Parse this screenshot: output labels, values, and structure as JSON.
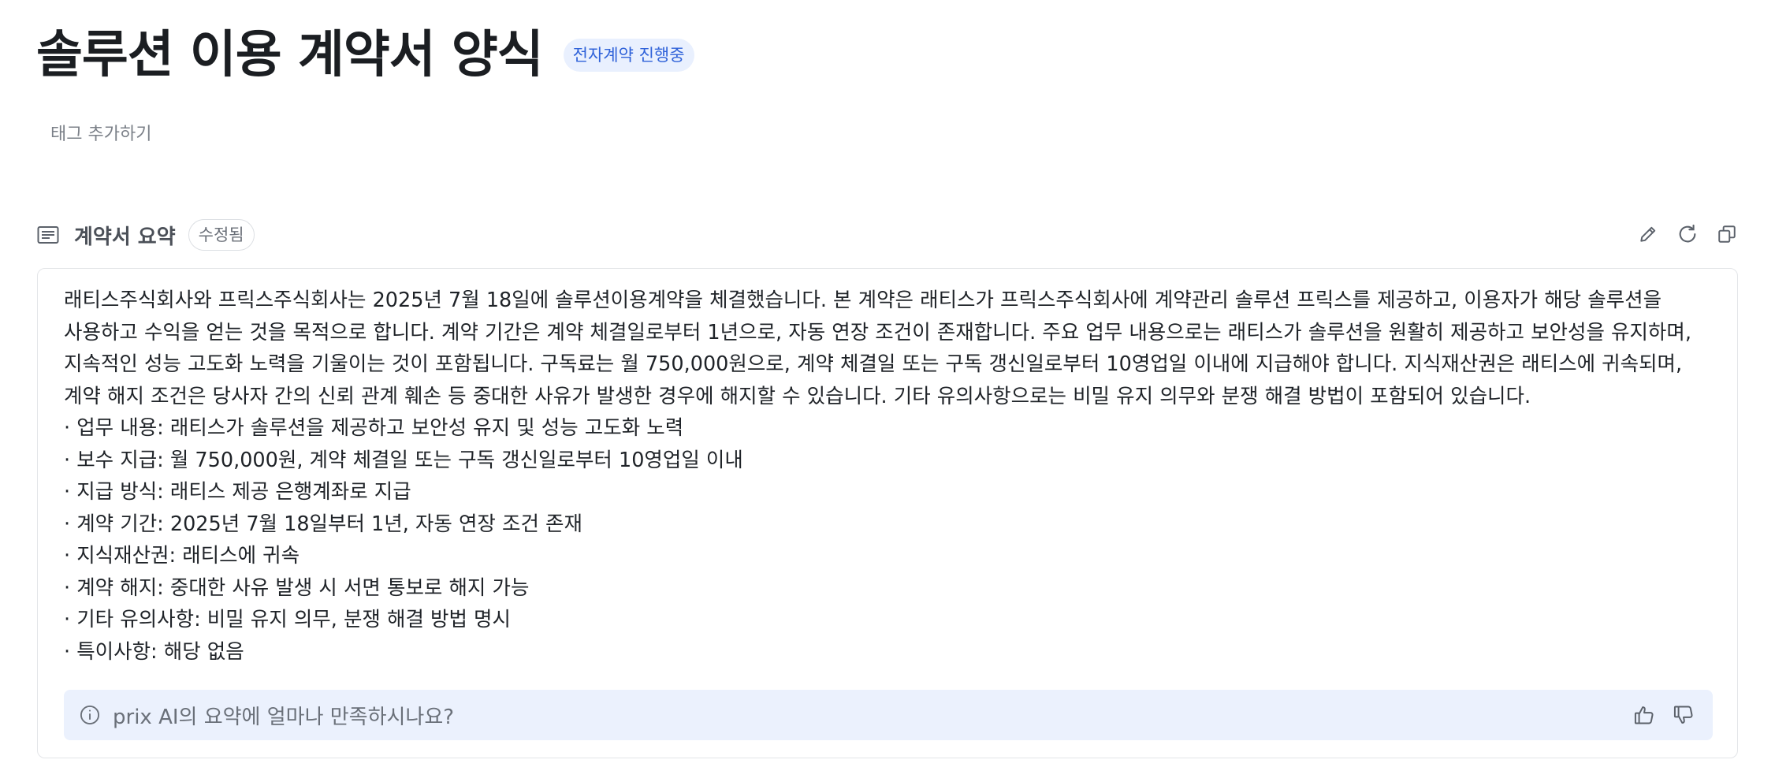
{
  "header": {
    "title": "솔루션 이용 계약서 양식",
    "status_badge": "전자계약 진행중",
    "tag_add_label": "태그 추가하기"
  },
  "summary": {
    "section_title": "계약서 요약",
    "edited_badge": "수정됨",
    "icons": [
      "document-lines-icon",
      "pencil-icon",
      "refresh-icon",
      "copy-icon"
    ],
    "paragraph": "래티스주식회사와 프릭스주식회사는 2025년 7월 18일에 솔루션이용계약을 체결했습니다. 본 계약은 래티스가 프릭스주식회사에 계약관리 솔루션 프릭스를 제공하고, 이용자가 해당 솔루션을 사용하고 수익을 얻는 것을 목적으로 합니다. 계약 기간은 계약 체결일로부터 1년으로, 자동 연장 조건이 존재합니다. 주요 업무 내용으로는 래티스가 솔루션을 원활히 제공하고 보안성을 유지하며, 지속적인 성능 고도화 노력을 기울이는 것이 포함됩니다. 구독료는 월 750,000원으로, 계약 체결일 또는 구독 갱신일로부터 10영업일 이내에 지급해야 합니다. 지식재산권은 래티스에 귀속되며, 계약 해지 조건은 당사자 간의 신뢰 관계 훼손 등 중대한 사유가 발생한 경우에 해지할 수 있습니다. 기타 유의사항으로는 비밀 유지 의무와 분쟁 해결 방법이 포함되어 있습니다.",
    "bullets": [
      "· 업무 내용: 래티스가 솔루션을 제공하고 보안성 유지 및 성능 고도화 노력",
      "· 보수 지급: 월 750,000원, 계약 체결일 또는 구독 갱신일로부터 10영업일 이내",
      "· 지급 방식: 래티스 제공 은행계좌로 지급",
      "· 계약 기간: 2025년 7월 18일부터 1년, 자동 연장 조건 존재",
      "· 지식재산권: 래티스에 귀속",
      "· 계약 해지: 중대한 사유 발생 시 서면 통보로 해지 가능",
      "· 기타 유의사항: 비밀 유지 의무, 분쟁 해결 방법 명시",
      "· 특이사항: 해당 없음"
    ]
  },
  "feedback": {
    "prompt": "prix AI의 요약에 얼마나 만족하시나요?",
    "icons": [
      "info-icon",
      "thumbs-up-icon",
      "thumbs-down-icon"
    ]
  },
  "colors": {
    "accent": "#2f62d9",
    "badge_bg": "#e9f0fe",
    "feedback_bg": "#ebf1fd",
    "border": "#e3e5e8",
    "muted_text": "#7b8088"
  }
}
